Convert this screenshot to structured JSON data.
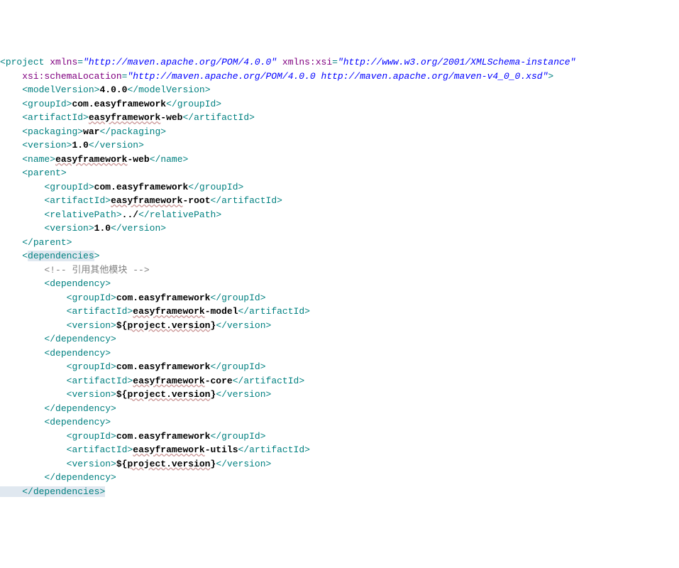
{
  "root": {
    "tag": "project",
    "attrs": {
      "xmlns": "\"http://maven.apache.org/POM/4.0.0\"",
      "xmlns_xsi": "\"http://www.w3.org/2001/XMLSchema-instance\"",
      "xsi_schemaLocation": "\"http://maven.apache.org/POM/4.0.0 http://maven.apache.org/maven-v4_0_0.xsd\""
    }
  },
  "lines": {
    "modelVersion": {
      "tag": "modelVersion",
      "value": "4.0.0"
    },
    "groupId": {
      "tag": "groupId",
      "value": "com.easyframework"
    },
    "artifactId": {
      "tag": "artifactId",
      "prefix": "easyframework",
      "suffix": "-web"
    },
    "packaging": {
      "tag": "packaging",
      "value": "war"
    },
    "version": {
      "tag": "version",
      "value": "1.0"
    },
    "name": {
      "tag": "name",
      "prefix": "easyframework",
      "suffix": "-web"
    },
    "parent": {
      "tag": "parent",
      "groupId": {
        "tag": "groupId",
        "value": "com.easyframework"
      },
      "artifactId": {
        "tag": "artifactId",
        "prefix": "easyframework",
        "suffix": "-root"
      },
      "relativePath": {
        "tag": "relativePath",
        "value": "../"
      },
      "version": {
        "tag": "version",
        "value": "1.0"
      }
    },
    "dependencies": {
      "tag": "dependencies",
      "comment": "<!-- 引用其他模块 -->",
      "deps": [
        {
          "tag": "dependency",
          "groupId": {
            "tag": "groupId",
            "value": "com.easyframework"
          },
          "artifactId": {
            "tag": "artifactId",
            "prefix": "easyframework",
            "suffix": "-model"
          },
          "version": {
            "tag": "version",
            "prefix": "${",
            "mid": "project.version",
            "suffix": "}"
          }
        },
        {
          "tag": "dependency",
          "groupId": {
            "tag": "groupId",
            "value": "com.easyframework"
          },
          "artifactId": {
            "tag": "artifactId",
            "prefix": "easyframework",
            "suffix": "-core"
          },
          "version": {
            "tag": "version",
            "prefix": "${",
            "mid": "project.version",
            "suffix": "}"
          }
        },
        {
          "tag": "dependency",
          "groupId": {
            "tag": "groupId",
            "value": "com.easyframework"
          },
          "artifactId": {
            "tag": "artifactId",
            "prefix": "easyframework",
            "suffix": "-utils"
          },
          "version": {
            "tag": "version",
            "prefix": "${",
            "mid": "project.version",
            "suffix": "}"
          }
        }
      ]
    }
  },
  "attr_labels": {
    "xmlns": "xmlns",
    "xmlns_xsi": "xmlns:xsi",
    "xsi_schemaLocation": "xsi:schemaLocation"
  }
}
